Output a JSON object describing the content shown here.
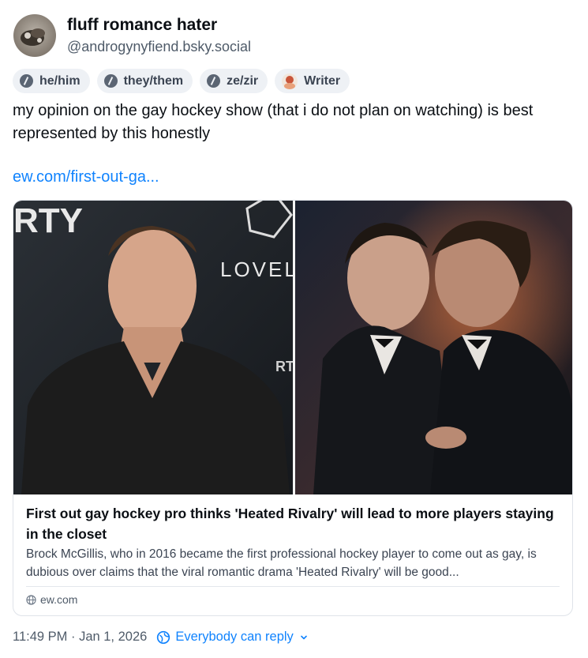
{
  "author": {
    "display_name": "fluff romance hater",
    "handle": "@androgynyfiend.bsky.social"
  },
  "labels": [
    {
      "label": "he/him",
      "icon": "pronoun-icon"
    },
    {
      "label": "they/them",
      "icon": "pronoun-icon"
    },
    {
      "label": "ze/zir",
      "icon": "pronoun-icon"
    },
    {
      "label": "Writer",
      "icon": "writer-avatar-icon"
    }
  ],
  "post": {
    "text": "my opinion on the gay hockey show (that i do not plan on watching) is best represented by this honestly",
    "link_text": "ew.com/first-out-ga..."
  },
  "embed_card": {
    "title": "First out gay hockey pro thinks 'Heated Rivalry' will lead to more players staying in the closet",
    "description": "Brock McGillis, who in 2016 became the first professional hockey player to come out as gay, is dubious over claims that the viral romantic drama 'Heated Rivalry' will be good...",
    "domain": "ew.com",
    "image_left_backdrop_text": "RTY",
    "image_left_backdrop_text_2": "LOVEL",
    "image_left_backdrop_text_3": "RT"
  },
  "footer": {
    "timestamp": "11:49 PM · Jan 1, 2026",
    "reply_setting": "Everybody can reply"
  },
  "colors": {
    "link": "#1083fe",
    "muted": "#4f5b69",
    "pill_bg": "#eef1f5"
  }
}
